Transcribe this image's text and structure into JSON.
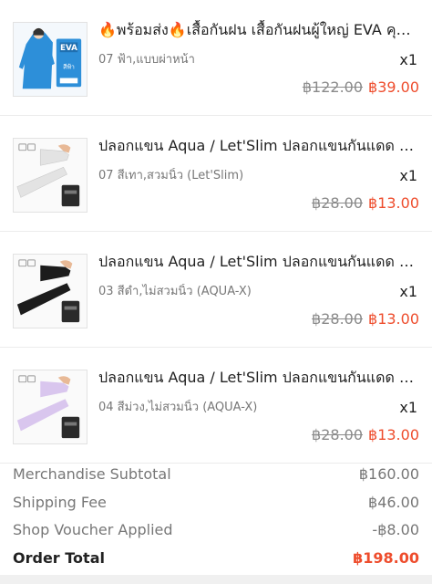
{
  "items": [
    {
      "title": "🔥พร้อมส่ง🔥เสื้อกันฝน เสื้อกันฝนผู้ใหญ่ EVA คุณ...",
      "variant": "07 ฟ้า,แบบผ่าหน้า",
      "qty": "x1",
      "old_price": "฿122.00",
      "new_price": "฿39.00",
      "image_icon": "raincoat-icon",
      "image_text": {
        "brand": "EVA",
        "sub": "สีฟ้า"
      }
    },
    {
      "title": "ปลอกแขน Aqua / Let'Slim ปลอกแขนกันแดด UV...",
      "variant": "07 สีเทา,สวมนิ้ว (Let'Slim)",
      "qty": "x1",
      "old_price": "฿28.00",
      "new_price": "฿13.00",
      "image_icon": "arm-sleeve-icon",
      "sleeve_color": "#e3e3e3"
    },
    {
      "title": "ปลอกแขน Aqua / Let'Slim ปลอกแขนกันแดด UV...",
      "variant": "03 สีดำ,ไม่สวมนิ้ว (AQUA-X)",
      "qty": "x1",
      "old_price": "฿28.00",
      "new_price": "฿13.00",
      "image_icon": "arm-sleeve-icon",
      "sleeve_color": "#1c1c1c"
    },
    {
      "title": "ปลอกแขน Aqua / Let'Slim ปลอกแขนกันแดด UV...",
      "variant": "04 สีม่วง,ไม่สวมนิ้ว (AQUA-X)",
      "qty": "x1",
      "old_price": "฿28.00",
      "new_price": "฿13.00",
      "image_icon": "arm-sleeve-icon",
      "sleeve_color": "#d9c6ee"
    }
  ],
  "summary": {
    "merchandise_subtotal_label": "Merchandise Subtotal",
    "merchandise_subtotal_value": "฿160.00",
    "shipping_fee_label": "Shipping Fee",
    "shipping_fee_value": "฿46.00",
    "shop_voucher_label": "Shop Voucher Applied",
    "shop_voucher_value": "-฿8.00",
    "order_total_label": "Order Total",
    "order_total_value": "฿198.00"
  },
  "colors": {
    "accent": "#ee4d2d",
    "muted": "#777777",
    "strike": "#8a8a8a",
    "raincoat": "#2d8fd9"
  }
}
